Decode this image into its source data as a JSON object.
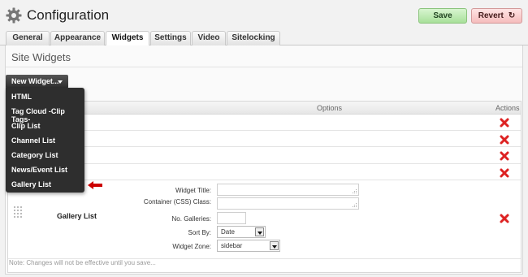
{
  "header": {
    "title": "Configuration",
    "save_label": "Save",
    "revert_label": "Revert",
    "gear_icon": "gear-icon",
    "revert_icon": "refresh-icon"
  },
  "tabs": [
    {
      "label": "General",
      "active": false
    },
    {
      "label": "Appearance",
      "active": false
    },
    {
      "label": "Widgets",
      "active": true
    },
    {
      "label": "Settings",
      "active": false
    },
    {
      "label": "Video",
      "active": false
    },
    {
      "label": "Sitelocking",
      "active": false
    }
  ],
  "section": {
    "title": "Site Widgets"
  },
  "new_widget": {
    "label": "New Widget...",
    "menu": [
      "HTML",
      "Tag Cloud -Clip Tags-",
      "Clip List",
      "Channel List",
      "Category List",
      "News/Event List",
      "Gallery List"
    ]
  },
  "table": {
    "headers": {
      "options": "Options",
      "actions": "Actions"
    },
    "delete_icon": "delete-x-icon"
  },
  "gallery_widget": {
    "name": "Gallery List",
    "fields": {
      "title_label": "Widget Title:",
      "css_label": "Container (CSS) Class:",
      "galleries_label": "No. Galleries:",
      "sortby_label": "Sort By:",
      "sortby_value": "Date",
      "zone_label": "Widget Zone:",
      "zone_value": "sidebar"
    }
  },
  "note": "Note: Changes will not be effective until you save...",
  "colors": {
    "save": "#a8e09a",
    "revert": "#f5bcbc",
    "menu_bg": "#2e2e2e",
    "delete": "#dd2222",
    "pointer": "#cc0000"
  }
}
